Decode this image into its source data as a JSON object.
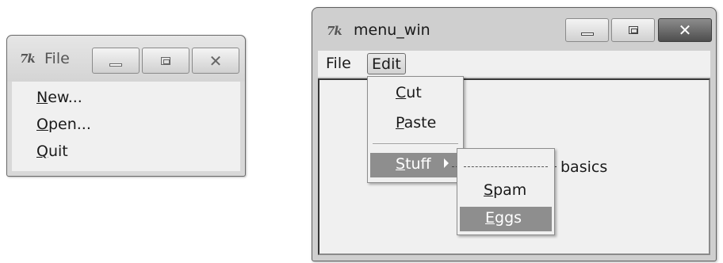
{
  "tearoff_window": {
    "title": "File",
    "items": [
      {
        "underline": "N",
        "rest": "ew..."
      },
      {
        "underline": "O",
        "rest": "pen..."
      },
      {
        "underline": "Q",
        "rest": "uit"
      }
    ]
  },
  "main_window": {
    "title": "menu_win",
    "menubar": {
      "file": "File",
      "edit": "Edit"
    },
    "edit_menu": {
      "cut": {
        "underline": "C",
        "rest": "ut"
      },
      "paste": {
        "underline": "P",
        "rest": "aste"
      },
      "stuff": {
        "underline": "S",
        "rest": "tuff"
      }
    },
    "stuff_menu": {
      "spam": {
        "underline": "S",
        "rest": "pam"
      },
      "eggs": {
        "underline": "E",
        "rest": "ggs"
      }
    },
    "body_text": "basics"
  },
  "icons": {
    "app_icon": "tk-feather-icon",
    "minimize": "minimize-icon",
    "maximize": "maximize-icon",
    "close": "close-icon",
    "submenu_arrow": "chevron-right-icon"
  },
  "colors": {
    "highlight": "#8e8e8e",
    "close_button": "#4e4e4e"
  }
}
